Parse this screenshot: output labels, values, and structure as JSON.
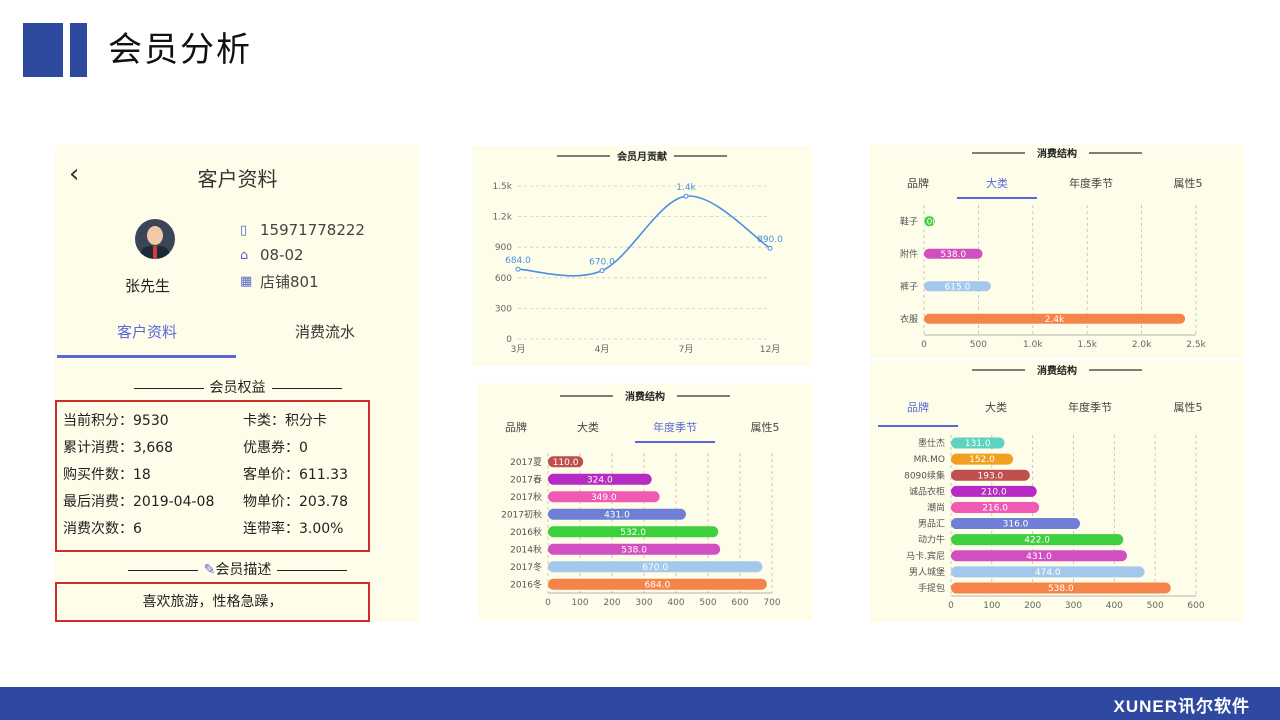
{
  "slide": {
    "title": "会员分析",
    "footer_brand": "XUNER讯尔软件",
    "accent_color": "#2e4a9e"
  },
  "customer": {
    "back_icon": "chevron-left-icon",
    "title": "客户资料",
    "name": "张先生",
    "phone": "15971778222",
    "date": "08-02",
    "store": "店铺801",
    "tabs": [
      {
        "label": "客户资料",
        "active": true
      },
      {
        "label": "消费流水",
        "active": false
      }
    ],
    "benefits_title": "会员权益",
    "benefits": [
      {
        "left": "当前积分：9530",
        "right": "卡类：积分卡"
      },
      {
        "left": "累计消费：3,668",
        "right": "优惠券：0"
      },
      {
        "left": "购买件数：18",
        "right": "客单价：611.33"
      },
      {
        "left": "最后消费：2019-04-08",
        "right": "物单价：203.78"
      },
      {
        "left": "消费次数：6",
        "right": "连带率：3.00%"
      }
    ],
    "description_title": "会员描述",
    "description": "喜欢旅游，性格急躁，"
  },
  "chart_data": [
    {
      "type": "line",
      "title": "会员月贡献",
      "x": [
        "3月",
        "4月",
        "7月",
        "12月"
      ],
      "series": [
        {
          "values": [
            684,
            670,
            1400,
            890
          ]
        }
      ],
      "data_labels": [
        "684.0",
        "670.0",
        "1.4k",
        "890.0"
      ],
      "y_ticks": [
        "0",
        "300",
        "600",
        "900",
        "1.2k",
        "1.5k"
      ],
      "ylim": [
        0,
        1500
      ],
      "grid": true,
      "color": "#4a90e2"
    },
    {
      "type": "bar",
      "orientation": "horizontal",
      "title": "消费结构",
      "tabs": [
        "品牌",
        "大类",
        "年度季节",
        "属性5"
      ],
      "active_tab": "年度季节",
      "categories": [
        "2017夏",
        "2017春",
        "2017秋",
        "2017初秋",
        "2016秋",
        "2014秋",
        "2017冬",
        "2016冬"
      ],
      "values": [
        110,
        324,
        349,
        431,
        532,
        538,
        670,
        684
      ],
      "labels": [
        "110.0",
        "324.0",
        "349.0",
        "431.0",
        "532.0",
        "538.0",
        "670.0",
        "684.0"
      ],
      "colors": [
        "#c0504d",
        "#b52bc4",
        "#f05ab4",
        "#6f7fd6",
        "#3ecf3e",
        "#d14fc0",
        "#a3c8ec",
        "#f5834a"
      ],
      "x_ticks": [
        "0",
        "100",
        "200",
        "300",
        "400",
        "500",
        "600",
        "700"
      ],
      "xlim": [
        0,
        700
      ]
    },
    {
      "type": "bar",
      "orientation": "horizontal",
      "title": "消费结构",
      "tabs": [
        "品牌",
        "大类",
        "年度季节",
        "属性5"
      ],
      "active_tab": "大类",
      "categories": [
        "鞋子",
        "附件",
        "裤子",
        "衣服"
      ],
      "values": [
        100,
        538,
        615,
        2400
      ],
      "labels": [
        "100",
        "538.0",
        "615.0",
        "2.4k"
      ],
      "colors": [
        "#3ecf3e",
        "#d14fc0",
        "#a3c8ec",
        "#f5834a"
      ],
      "x_ticks": [
        "0",
        "500",
        "1.0k",
        "1.5k",
        "2.0k",
        "2.5k"
      ],
      "xlim": [
        0,
        2500
      ]
    },
    {
      "type": "bar",
      "orientation": "horizontal",
      "title": "消费结构",
      "tabs": [
        "品牌",
        "大类",
        "年度季节",
        "属性5"
      ],
      "active_tab": "品牌",
      "categories": [
        "墨仕杰",
        "MR.MO",
        "8090续集",
        "诚品衣柜",
        "潮尚",
        "男品汇",
        "动力牛",
        "马卡.宾尼",
        "男人城堡",
        "手提包"
      ],
      "values": [
        131,
        152,
        193,
        210,
        216,
        316,
        422,
        431,
        474,
        538
      ],
      "labels": [
        "131.0",
        "152.0",
        "193.0",
        "210.0",
        "216.0",
        "316.0",
        "422.0",
        "431.0",
        "474.0",
        "538.0"
      ],
      "colors": [
        "#5fd3c0",
        "#f0a020",
        "#c0504d",
        "#b52bc4",
        "#f05ab4",
        "#6f7fd6",
        "#3ecf3e",
        "#d14fc0",
        "#a3c8ec",
        "#f5834a"
      ],
      "x_ticks": [
        "0",
        "100",
        "200",
        "300",
        "400",
        "500",
        "600"
      ],
      "xlim": [
        0,
        600
      ]
    }
  ]
}
